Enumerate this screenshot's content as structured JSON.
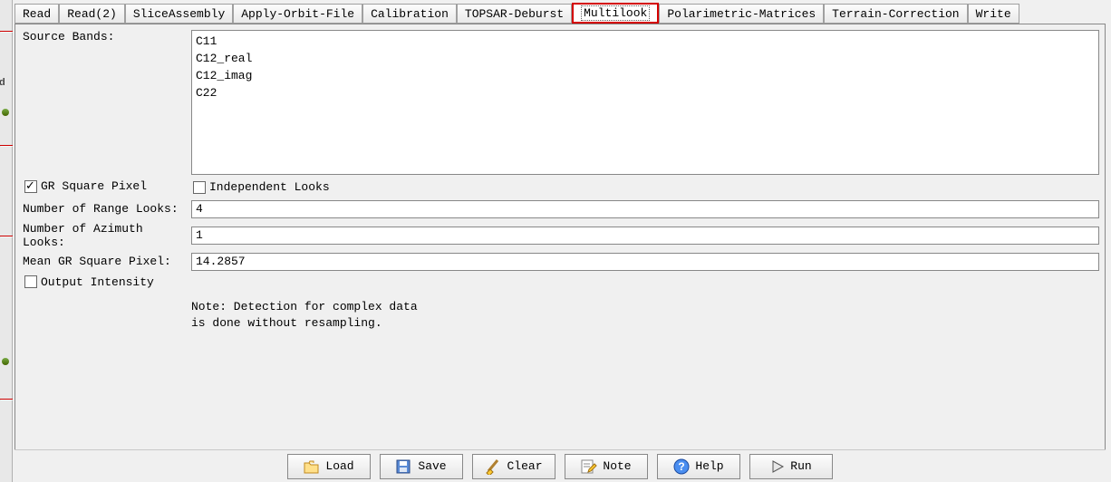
{
  "tabs": [
    "Read",
    "Read(2)",
    "SliceAssembly",
    "Apply-Orbit-File",
    "Calibration",
    "TOPSAR-Deburst",
    "Multilook",
    "Polarimetric-Matrices",
    "Terrain-Correction",
    "Write"
  ],
  "active_tab_index": 6,
  "form": {
    "source_bands_label": "Source Bands:",
    "source_bands": [
      "C11",
      "C12_real",
      "C12_imag",
      "C22"
    ],
    "gr_square_pixel": {
      "label": "GR Square Pixel",
      "checked": true
    },
    "independent_looks": {
      "label": "Independent Looks",
      "checked": false
    },
    "n_range_looks": {
      "label": "Number of Range Looks:",
      "value": "4"
    },
    "n_azimuth_looks": {
      "label": "Number of Azimuth Looks:",
      "value": "1"
    },
    "mean_gr_square_pixel": {
      "label": "Mean GR Square Pixel:",
      "value": "14.2857"
    },
    "output_intensity": {
      "label": "Output Intensity",
      "checked": false
    },
    "note": "Note: Detection for complex data\nis done without resampling."
  },
  "buttons": {
    "load": "Load",
    "save": "Save",
    "clear": "Clear",
    "note": "Note",
    "help": "Help",
    "run": "Run"
  },
  "sliver_label": "ld"
}
